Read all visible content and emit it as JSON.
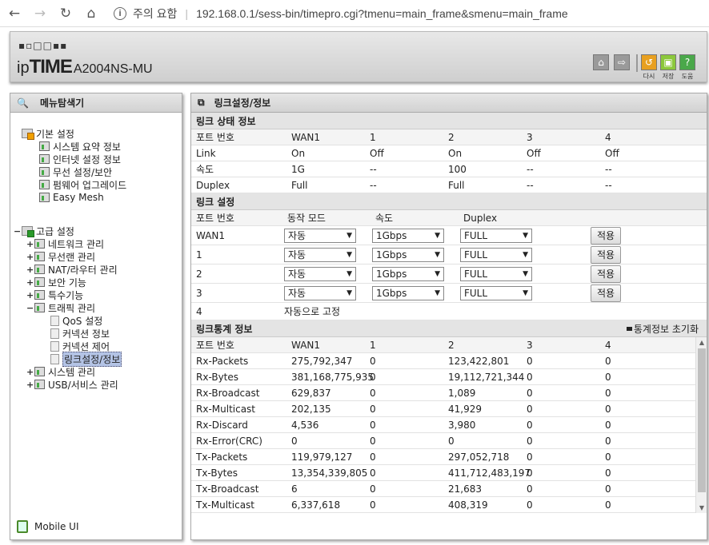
{
  "browser": {
    "security_label": "주의 요함",
    "url": "192.168.0.1/sess-bin/timepro.cgi?tmenu=main_frame&smenu=main_frame"
  },
  "header": {
    "brand_ip": "ip",
    "brand_time": "TIME",
    "model": "A2004NS-MU",
    "actions": [
      {
        "label": "다시",
        "icon": "refresh-icon",
        "color": "#e8a020"
      },
      {
        "label": "저장",
        "icon": "save-icon",
        "color": "#8cc83c"
      },
      {
        "label": "도움",
        "icon": "help-icon",
        "color": "#4aa84a"
      }
    ]
  },
  "sidebar": {
    "title": "메뉴탐색기",
    "basic_group": "기본 설정",
    "basic_items": [
      "시스템 요약 정보",
      "인터넷 설정 정보",
      "무선 설정/보안",
      "펌웨어 업그레이드",
      "Easy Mesh"
    ],
    "advanced_group": "고급 설정",
    "advanced_items": [
      "네트워크 관리",
      "무선랜 관리",
      "NAT/라우터 관리",
      "보안 기능",
      "특수기능",
      "트래픽 관리"
    ],
    "traffic_items": [
      "QoS 설정",
      "커넥션 정보",
      "커넥션 제어",
      "링크설정/정보"
    ],
    "advanced_items_after": [
      "시스템 관리",
      "USB/서비스 관리"
    ],
    "mobile_ui": "Mobile UI"
  },
  "content": {
    "title": "링크설정/정보",
    "status": {
      "heading": "링크 상태 정보",
      "columns": [
        "포트 번호",
        "WAN1",
        "1",
        "2",
        "3",
        "4"
      ],
      "rows": [
        [
          "Link",
          "On",
          "Off",
          "On",
          "Off",
          "Off"
        ],
        [
          "속도",
          "1G",
          "--",
          "100",
          "--",
          "--"
        ],
        [
          "Duplex",
          "Full",
          "--",
          "Full",
          "--",
          "--"
        ]
      ]
    },
    "config": {
      "heading": "링크 설정",
      "columns": [
        "포트 번호",
        "동작 모드",
        "속도",
        "Duplex"
      ],
      "rows": [
        {
          "port": "WAN1",
          "mode": "자동",
          "speed": "1Gbps",
          "duplex": "FULL",
          "apply": "적용"
        },
        {
          "port": "1",
          "mode": "자동",
          "speed": "1Gbps",
          "duplex": "FULL",
          "apply": "적용"
        },
        {
          "port": "2",
          "mode": "자동",
          "speed": "1Gbps",
          "duplex": "FULL",
          "apply": "적용"
        },
        {
          "port": "3",
          "mode": "자동",
          "speed": "1Gbps",
          "duplex": "FULL",
          "apply": "적용"
        }
      ],
      "fixed_port": "4",
      "fixed_text": "자동으로 고정"
    },
    "stats": {
      "heading": "링크통계 정보",
      "reset_label": "통계정보 초기화",
      "columns": [
        "포트 번호",
        "WAN1",
        "1",
        "2",
        "3",
        "4"
      ],
      "rows": [
        [
          "Rx-Packets",
          "275,792,347",
          "0",
          "123,422,801",
          "0",
          "0"
        ],
        [
          "Rx-Bytes",
          "381,168,775,935",
          "0",
          "19,112,721,344",
          "0",
          "0"
        ],
        [
          "Rx-Broadcast",
          "629,837",
          "0",
          "1,089",
          "0",
          "0"
        ],
        [
          "Rx-Multicast",
          "202,135",
          "0",
          "41,929",
          "0",
          "0"
        ],
        [
          "Rx-Discard",
          "4,536",
          "0",
          "3,980",
          "0",
          "0"
        ],
        [
          "Rx-Error(CRC)",
          "0",
          "0",
          "0",
          "0",
          "0"
        ],
        [
          "Tx-Packets",
          "119,979,127",
          "0",
          "297,052,718",
          "0",
          "0"
        ],
        [
          "Tx-Bytes",
          "13,354,339,805",
          "0",
          "411,712,483,197",
          "0",
          "0"
        ],
        [
          "Tx-Broadcast",
          "6",
          "0",
          "21,683",
          "0",
          "0"
        ],
        [
          "Tx-Multicast",
          "6,337,618",
          "0",
          "408,319",
          "0",
          "0"
        ]
      ]
    }
  }
}
